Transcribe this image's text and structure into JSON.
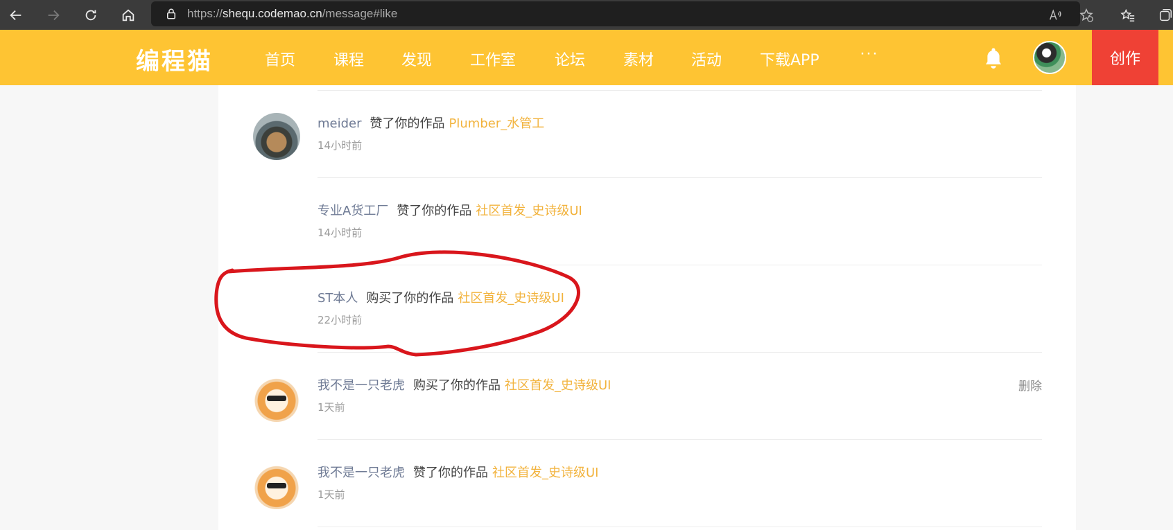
{
  "browser": {
    "url_scheme": "https://",
    "url_host": "shequ.codemao.cn",
    "url_path": "/message#like"
  },
  "header": {
    "logo": "编程猫",
    "nav": [
      {
        "label": "首页"
      },
      {
        "label": "课程"
      },
      {
        "label": "发现"
      },
      {
        "label": "工作室"
      },
      {
        "label": "论坛"
      },
      {
        "label": "素材"
      },
      {
        "label": "活动"
      },
      {
        "label": "下载APP"
      }
    ],
    "more": "···",
    "create_label": "创作"
  },
  "messages": [
    {
      "user": "meider",
      "action": "赞了你的作品",
      "work": "Plumber_水管工",
      "time": "14小时前",
      "avatar": "meider-avatar",
      "delete": ""
    },
    {
      "user": "专业A货工厂",
      "action": "赞了你的作品",
      "work": "社区首发_史诗级UI",
      "time": "14小时前",
      "avatar": "",
      "delete": ""
    },
    {
      "user": "ST本人",
      "action": "购买了你的作品",
      "work": "社区首发_史诗级UI",
      "time": "22小时前",
      "avatar": "",
      "delete": ""
    },
    {
      "user": "我不是一只老虎",
      "action": "购买了你的作品",
      "work": "社区首发_史诗级UI",
      "time": "1天前",
      "avatar": "tiger-avatar",
      "delete": "删除"
    },
    {
      "user": "我不是一只老虎",
      "action": "赞了你的作品",
      "work": "社区首发_史诗级UI",
      "time": "1天前",
      "avatar": "tiger-avatar",
      "delete": ""
    }
  ],
  "colors": {
    "header_bg": "#fec433",
    "create_bg": "#ef4135",
    "link": "#f2b33d",
    "user": "#6f7b95",
    "annotation": "#d9161c"
  }
}
